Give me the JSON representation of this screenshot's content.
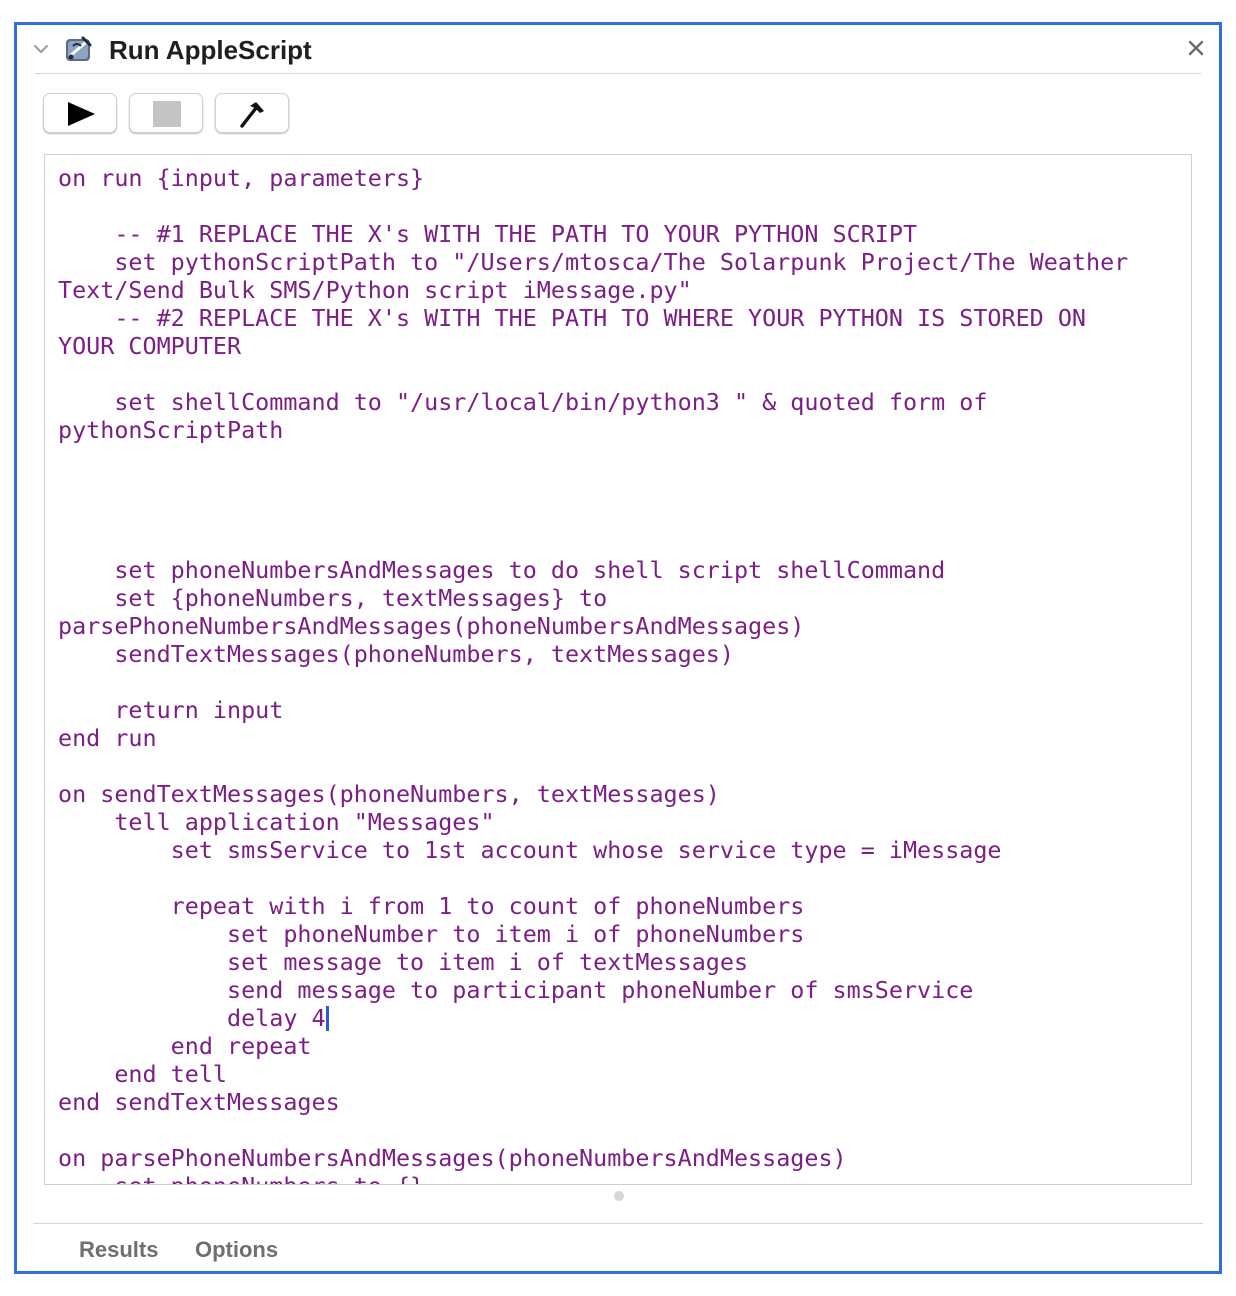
{
  "action": {
    "title": "Run AppleScript",
    "icon": "automator-script-icon"
  },
  "header": {
    "collapse_icon": "chevron-down-icon",
    "close_icon": "close-icon"
  },
  "toolbar": {
    "run_icon": "play-icon",
    "stop_icon": "stop-icon",
    "compile_icon": "hammer-icon"
  },
  "editor": {
    "code_before_caret": "on run {input, parameters}\n\n    -- #1 REPLACE THE X's WITH THE PATH TO YOUR PYTHON SCRIPT\n    set pythonScriptPath to \"/Users/mtosca/The Solarpunk Project/The Weather\nText/Send Bulk SMS/Python script iMessage.py\"\n    -- #2 REPLACE THE X's WITH THE PATH TO WHERE YOUR PYTHON IS STORED ON\nYOUR COMPUTER\n\n    set shellCommand to \"/usr/local/bin/python3 \" & quoted form of\npythonScriptPath\n\n\n\n\n    set phoneNumbersAndMessages to do shell script shellCommand\n    set {phoneNumbers, textMessages} to\nparsePhoneNumbersAndMessages(phoneNumbersAndMessages)\n    sendTextMessages(phoneNumbers, textMessages)\n\n    return input\nend run\n\non sendTextMessages(phoneNumbers, textMessages)\n    tell application \"Messages\"\n        set smsService to 1st account whose service type = iMessage\n\n        repeat with i from 1 to count of phoneNumbers\n            set phoneNumber to item i of phoneNumbers\n            set message to item i of textMessages\n            send message to participant phoneNumber of smsService\n            delay 4",
    "code_after_caret": "\n        end repeat\n    end tell\nend sendTextMessages\n\non parsePhoneNumbersAndMessages(phoneNumbersAndMessages)\n    set phoneNumbers to {}\n    set textMessages to {}"
  },
  "footer": {
    "tabs": [
      {
        "label": "Results"
      },
      {
        "label": "Options"
      }
    ]
  },
  "colors": {
    "accent_border": "#2f6fdd",
    "code_text": "#7b1f85",
    "caret": "#2b5bd9"
  }
}
